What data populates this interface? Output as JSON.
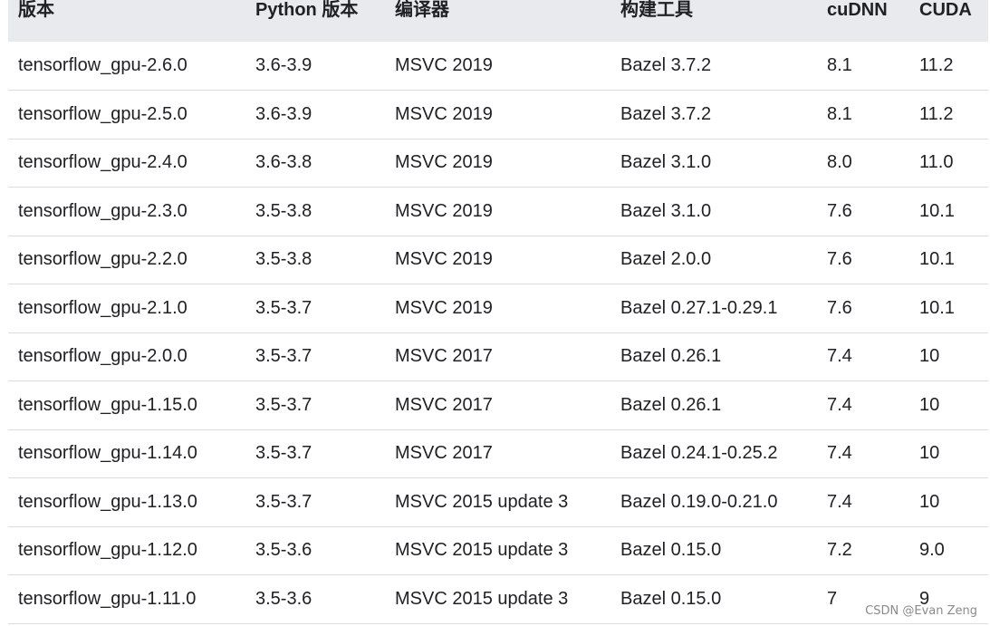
{
  "table": {
    "headers": [
      "版本",
      "Python 版本",
      "编译器",
      "构建工具",
      "cuDNN",
      "CUDA"
    ],
    "rows": [
      [
        "tensorflow_gpu-2.6.0",
        "3.6-3.9",
        "MSVC 2019",
        "Bazel 3.7.2",
        "8.1",
        "11.2"
      ],
      [
        "tensorflow_gpu-2.5.0",
        "3.6-3.9",
        "MSVC 2019",
        "Bazel 3.7.2",
        "8.1",
        "11.2"
      ],
      [
        "tensorflow_gpu-2.4.0",
        "3.6-3.8",
        "MSVC 2019",
        "Bazel 3.1.0",
        "8.0",
        "11.0"
      ],
      [
        "tensorflow_gpu-2.3.0",
        "3.5-3.8",
        "MSVC 2019",
        "Bazel 3.1.0",
        "7.6",
        "10.1"
      ],
      [
        "tensorflow_gpu-2.2.0",
        "3.5-3.8",
        "MSVC 2019",
        "Bazel 2.0.0",
        "7.6",
        "10.1"
      ],
      [
        "tensorflow_gpu-2.1.0",
        "3.5-3.7",
        "MSVC 2019",
        "Bazel 0.27.1-0.29.1",
        "7.6",
        "10.1"
      ],
      [
        "tensorflow_gpu-2.0.0",
        "3.5-3.7",
        "MSVC 2017",
        "Bazel 0.26.1",
        "7.4",
        "10"
      ],
      [
        "tensorflow_gpu-1.15.0",
        "3.5-3.7",
        "MSVC 2017",
        "Bazel 0.26.1",
        "7.4",
        "10"
      ],
      [
        "tensorflow_gpu-1.14.0",
        "3.5-3.7",
        "MSVC 2017",
        "Bazel 0.24.1-0.25.2",
        "7.4",
        "10"
      ],
      [
        "tensorflow_gpu-1.13.0",
        "3.5-3.7",
        "MSVC 2015 update 3",
        "Bazel 0.19.0-0.21.0",
        "7.4",
        "10"
      ],
      [
        "tensorflow_gpu-1.12.0",
        "3.5-3.6",
        "MSVC 2015 update 3",
        "Bazel 0.15.0",
        "7.2",
        "9.0"
      ],
      [
        "tensorflow_gpu-1.11.0",
        "3.5-3.6",
        "MSVC 2015 update 3",
        "Bazel 0.15.0",
        "7",
        "9"
      ]
    ]
  },
  "watermark": "CSDN @Evan Zeng",
  "colors": {
    "header_bg": "#e8eaed",
    "row_border": "#dadce0",
    "text": "#202124"
  }
}
